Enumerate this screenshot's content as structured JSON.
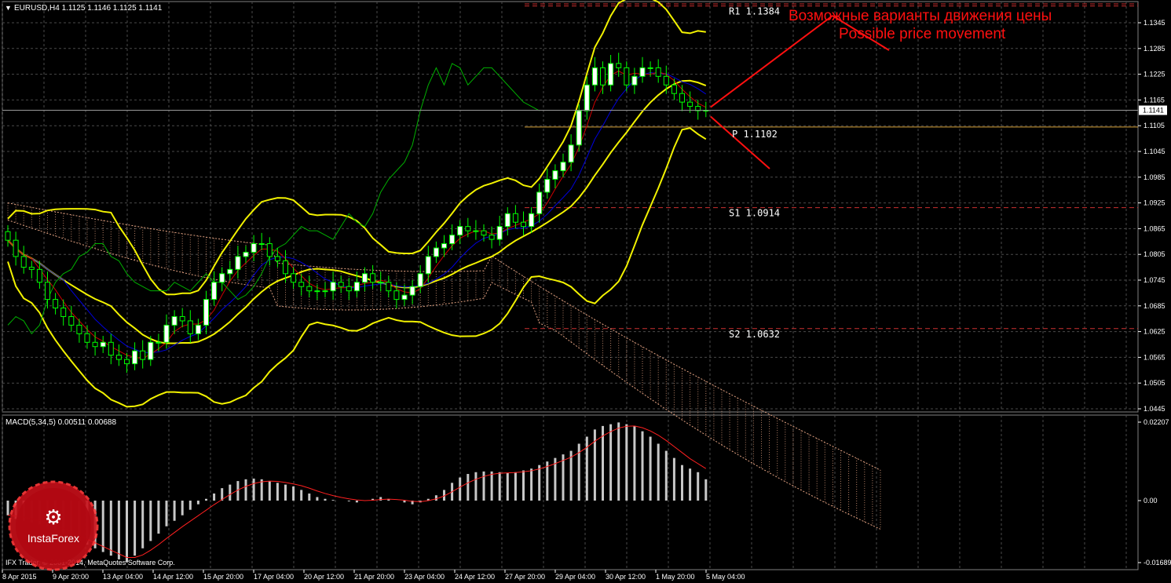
{
  "window": {
    "symbol_caption": "EURUSD,H4  1.1125 1.1146 1.1125 1.1141",
    "indicator_caption": "MACD(5,34,5) 0.00511 0.00688",
    "copyright": "IFX Trader, © 2001-2014, MetaQuotes Software Corp.",
    "logo_text": "InstaForex",
    "icon": "chevron-down-icon"
  },
  "annotations": {
    "ru": "Возможные варианты движения цены",
    "en": "Possible price movement"
  },
  "levels": [
    {
      "label": "R1  1.1384",
      "value": 1.1384
    },
    {
      "label": "P  1.1102",
      "value": 1.1102
    },
    {
      "label": "S1  1.0914",
      "value": 1.0914
    },
    {
      "label": "S2  1.0632",
      "value": 1.0632
    }
  ],
  "colors": {
    "background": "#000000",
    "grid": "#4a4a4a",
    "bollinger": "#f2f200",
    "fast_ma": "#0000dd",
    "medium_ma": "#cc0000",
    "slow_ma": "#00b000",
    "bull_candle": "#ffffff",
    "bear_candle": "#000000",
    "candle_wick": "#00ff00",
    "cloud": "#e0a080",
    "pivot": "#d9a43a",
    "annotation": "#ff1010",
    "macd_hist": "#c8c8c8",
    "macd_signal": "#ff2020",
    "axis_text": "#ffffff"
  },
  "chart_data": {
    "type": "candlestick",
    "symbol": "EURUSD",
    "timeframe": "H4",
    "price_axis": {
      "ticks": [
        "1.1345",
        "1.1285",
        "1.1225",
        "1.1165",
        "1.1105",
        "1.1045",
        "1.0985",
        "1.0925",
        "1.0865",
        "1.0805",
        "1.0745",
        "1.0685",
        "1.0625",
        "1.0565",
        "1.0505",
        "1.0445"
      ],
      "range": [
        1.0445,
        1.1375
      ],
      "current_price": "1.1141"
    },
    "time_axis": {
      "labels": [
        "8 Apr 2015",
        "9 Apr 20:00",
        "13 Apr 04:00",
        "14 Apr 12:00",
        "15 Apr 20:00",
        "17 Apr 04:00",
        "20 Apr 12:00",
        "21 Apr 20:00",
        "23 Apr 04:00",
        "24 Apr 12:00",
        "27 Apr 20:00",
        "29 Apr 04:00",
        "30 Apr 12:00",
        "1 May 20:00",
        "5 May 04:00"
      ]
    },
    "close": [
      1.0838,
      1.08,
      1.0775,
      1.077,
      1.074,
      1.07,
      1.068,
      1.066,
      1.064,
      1.062,
      1.06,
      1.059,
      1.06,
      1.057,
      1.056,
      1.055,
      1.058,
      1.056,
      1.06,
      1.06,
      1.064,
      1.066,
      1.065,
      1.062,
      1.064,
      1.07,
      1.074,
      1.076,
      1.077,
      1.08,
      1.081,
      1.083,
      1.083,
      1.08,
      1.079,
      1.076,
      1.074,
      1.073,
      1.072,
      1.072,
      1.072,
      1.074,
      1.073,
      1.072,
      1.074,
      1.076,
      1.074,
      1.074,
      1.072,
      1.07,
      1.071,
      1.073,
      1.076,
      1.08,
      1.082,
      1.083,
      1.085,
      1.087,
      1.086,
      1.086,
      1.085,
      1.084,
      1.087,
      1.09,
      1.088,
      1.087,
      1.09,
      1.095,
      1.098,
      1.1,
      1.102,
      1.106,
      1.114,
      1.12,
      1.124,
      1.12,
      1.125,
      1.124,
      1.12,
      1.122,
      1.124,
      1.124,
      1.122,
      1.12,
      1.118,
      1.116,
      1.115,
      1.114,
      1.1141
    ],
    "macd": {
      "axis_ticks": [
        "0.02207",
        "0.00",
        "-0.01689"
      ],
      "range": [
        -0.01689,
        0.02207
      ],
      "histogram": [
        -0.004,
        -0.005,
        -0.0055,
        -0.006,
        -0.0065,
        -0.007,
        -0.008,
        -0.009,
        -0.01,
        -0.011,
        -0.012,
        -0.013,
        -0.014,
        -0.015,
        -0.016,
        -0.0168,
        -0.015,
        -0.013,
        -0.011,
        -0.009,
        -0.007,
        -0.0055,
        -0.004,
        -0.0025,
        -0.001,
        0.0005,
        0.002,
        0.0035,
        0.0045,
        0.0055,
        0.006,
        0.0062,
        0.006,
        0.0055,
        0.005,
        0.0045,
        0.004,
        0.003,
        0.002,
        0.001,
        0.0005,
        0.0002,
        0.0,
        -0.0002,
        -0.0005,
        0.0,
        0.0005,
        0.001,
        0.0005,
        0.0,
        -0.0005,
        -0.001,
        -0.0005,
        0.0005,
        0.0015,
        0.003,
        0.005,
        0.0065,
        0.0075,
        0.008,
        0.0082,
        0.0082,
        0.008,
        0.0078,
        0.008,
        0.0085,
        0.009,
        0.01,
        0.011,
        0.012,
        0.013,
        0.014,
        0.016,
        0.018,
        0.02,
        0.021,
        0.0215,
        0.022,
        0.0215,
        0.021,
        0.0195,
        0.018,
        0.016,
        0.014,
        0.012,
        0.01,
        0.009,
        0.008,
        0.006
      ],
      "signal": [
        -0.004,
        -0.0042,
        -0.0045,
        -0.005,
        -0.0055,
        -0.006,
        -0.0067,
        -0.0075,
        -0.0085,
        -0.0095,
        -0.0105,
        -0.0115,
        -0.0125,
        -0.0135,
        -0.0145,
        -0.0155,
        -0.0155,
        -0.0148,
        -0.0135,
        -0.012,
        -0.0103,
        -0.0087,
        -0.0071,
        -0.0056,
        -0.0041,
        -0.0026,
        -0.0011,
        0.0003,
        0.0017,
        0.003,
        0.004,
        0.0048,
        0.0053,
        0.0055,
        0.0054,
        0.0051,
        0.0047,
        0.0042,
        0.0035,
        0.0027,
        0.002,
        0.0014,
        0.0009,
        0.0005,
        0.0002,
        0.0,
        0.0001,
        0.0003,
        0.0004,
        0.0003,
        0.0001,
        -0.0002,
        -0.0003,
        0.0,
        0.0005,
        0.0013,
        0.0025,
        0.0038,
        0.005,
        0.006,
        0.0068,
        0.0074,
        0.0077,
        0.0078,
        0.0079,
        0.0081,
        0.0084,
        0.0089,
        0.0096,
        0.0104,
        0.0113,
        0.0122,
        0.0135,
        0.015,
        0.0167,
        0.0182,
        0.0194,
        0.0204,
        0.0209,
        0.021,
        0.0205,
        0.0196,
        0.0184,
        0.0169,
        0.0152,
        0.0135,
        0.0118,
        0.0104,
        0.009
      ]
    }
  }
}
